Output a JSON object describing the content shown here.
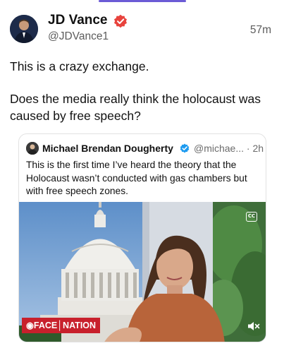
{
  "post": {
    "author_name": "JD Vance",
    "handle": "@JDVance1",
    "timestamp": "57m",
    "text_lines": [
      "This is a crazy exchange.",
      "Does the media really think the holocaust was caused by free speech?"
    ]
  },
  "quoted_post": {
    "author_name": "Michael Brendan Dougherty",
    "handle_time": "@michae... · 2h",
    "text": "This is the first time I’ve heard the theory that the Holocaust wasn’t conducted with gas chambers but with free speech zones.",
    "video": {
      "logo_text": "◉FACE│NATION",
      "cc_label": "CC"
    }
  },
  "icons": {
    "verified": "verified-badge-icon",
    "mute": "speaker-muted-icon",
    "captions": "captions-icon"
  },
  "colors": {
    "verified_badge": "#e8433d",
    "logo_red": "#c8202c",
    "accent_indicator": "#6b5bd6"
  }
}
